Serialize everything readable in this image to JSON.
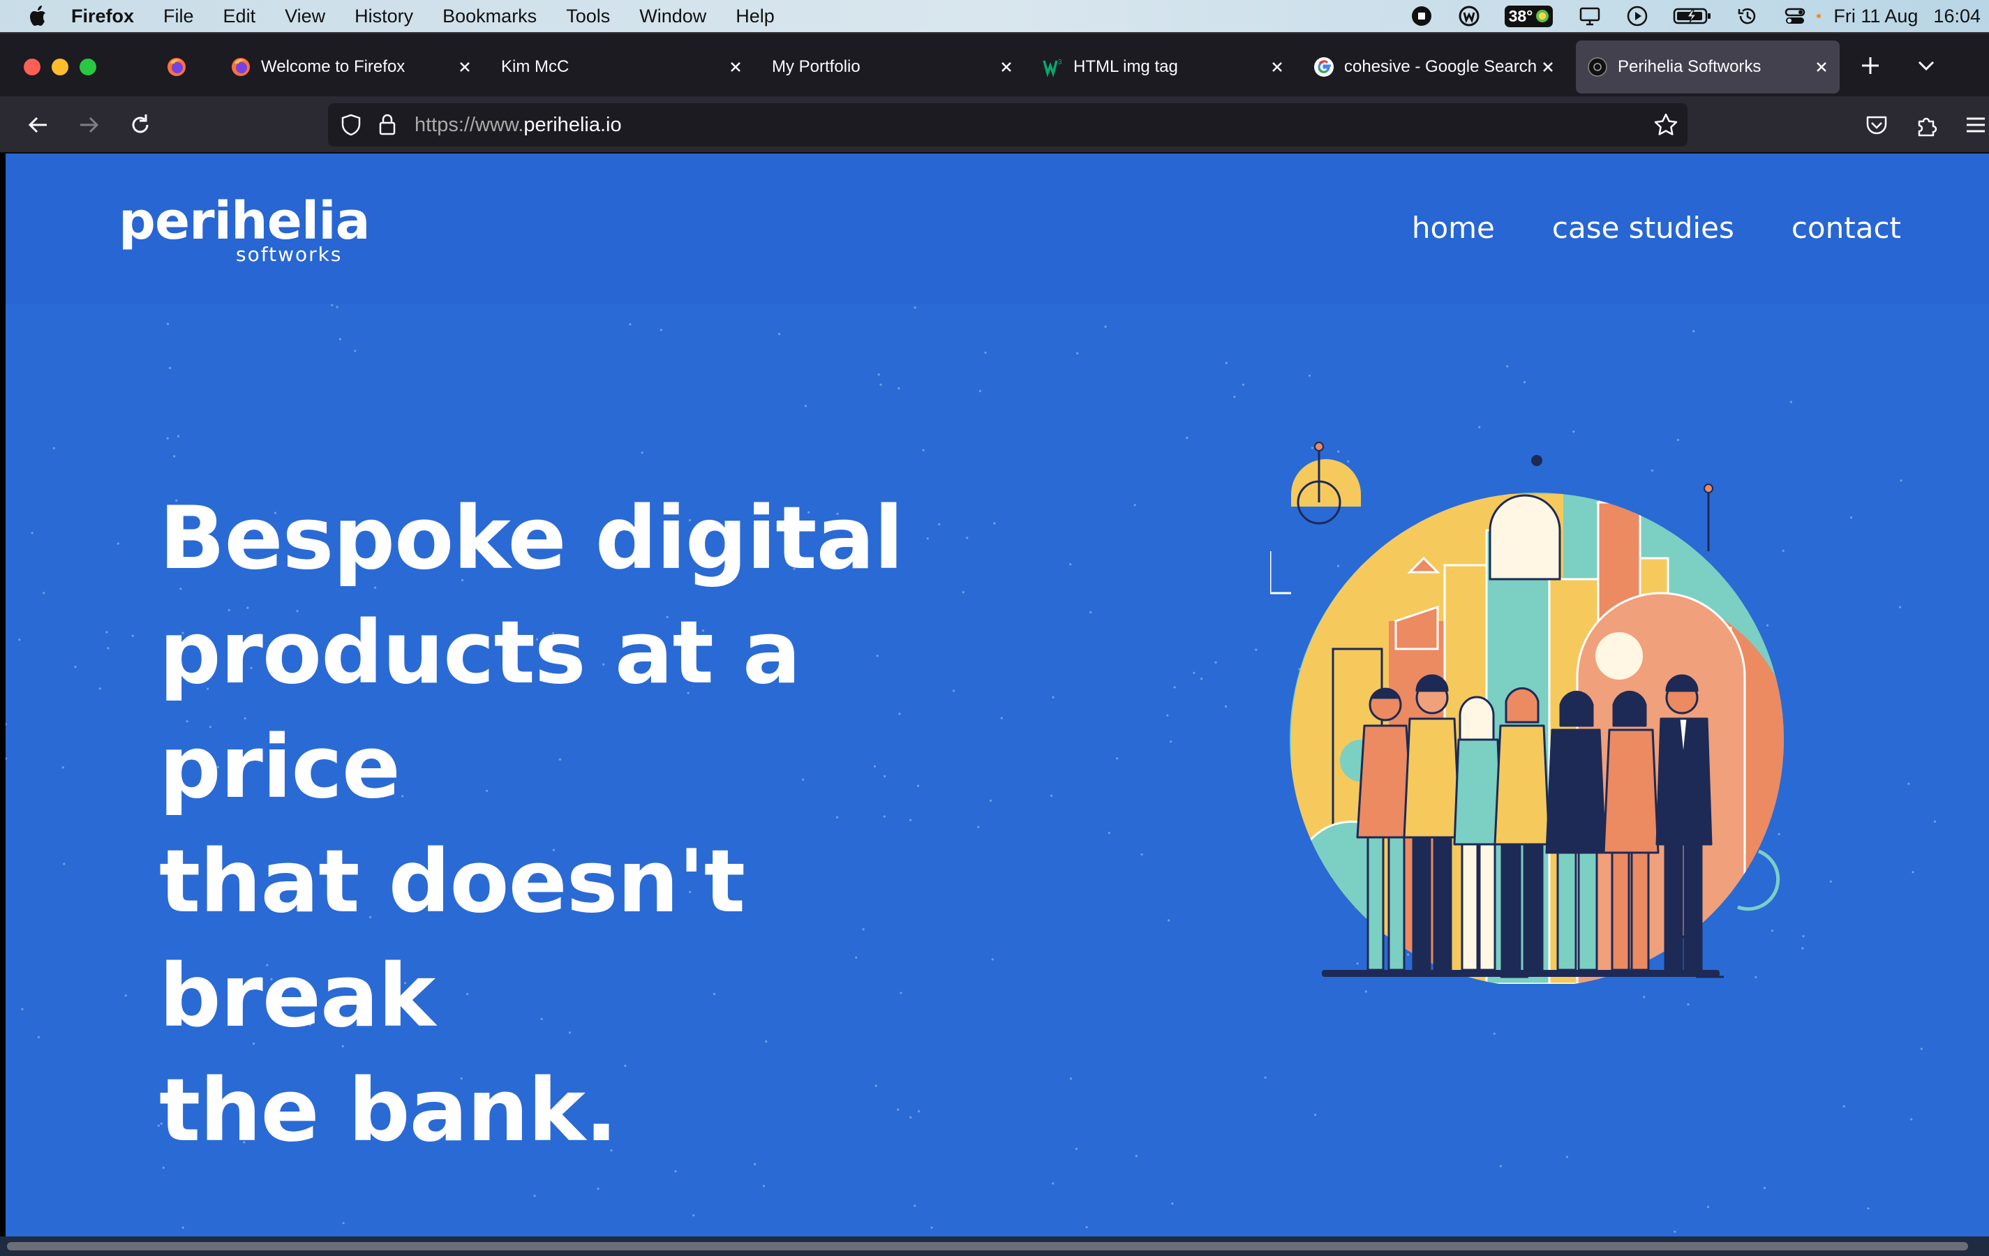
{
  "menubar": {
    "app": "Firefox",
    "menus": [
      "File",
      "Edit",
      "View",
      "History",
      "Bookmarks",
      "Tools",
      "Window",
      "Help"
    ],
    "temperature": "38°",
    "date": "Fri 11 Aug",
    "time": "16:04"
  },
  "tabs": [
    {
      "title": "",
      "icon": "firefox-icon"
    },
    {
      "title": "Welcome to Firefox",
      "icon": "firefox-icon"
    },
    {
      "title": "Kim McC",
      "icon": ""
    },
    {
      "title": "My Portfolio",
      "icon": ""
    },
    {
      "title": "HTML img tag",
      "icon": "w3schools-icon"
    },
    {
      "title": "cohesive - Google Search",
      "icon": "google-icon"
    },
    {
      "title": "Perihelia Softworks",
      "icon": "site-icon",
      "active": true
    }
  ],
  "urlbar": {
    "prefix": "https://www.",
    "domain": "perihelia.io"
  },
  "site": {
    "logo_main": "perihelia",
    "logo_sub": "softworks",
    "nav": [
      "home",
      "case studies",
      "contact"
    ],
    "hero_lines": [
      "Bespoke digital",
      "products at a price",
      "that doesn't break",
      "the bank."
    ]
  },
  "colors": {
    "page_bg": "#2a6ad5",
    "header_bg": "#2766d3",
    "illus_yellow": "#f5c95c",
    "illus_teal": "#7ccfc3",
    "illus_orange": "#ec8a62",
    "illus_navy": "#1d2a55"
  }
}
